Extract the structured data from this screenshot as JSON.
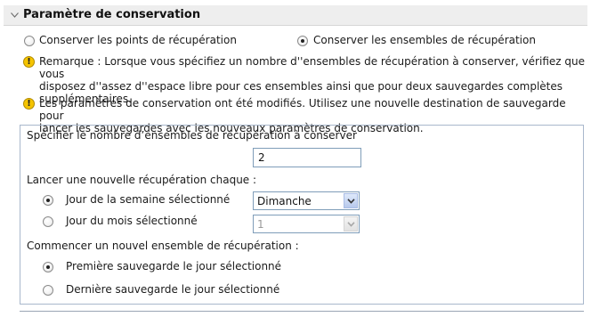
{
  "section": {
    "title": "Paramètre de conservation"
  },
  "mode": {
    "option_points": "Conserver les points de récupération",
    "option_sets": "Conserver les ensembles de récupération",
    "selected": "sets"
  },
  "notes": {
    "remark": [
      "Remarque : Lorsque vous spécifiez un nombre d''ensembles de récupération à conserver, vérifiez que vous",
      "disposez d''assez d''espace libre pour ces ensembles ainsi que pour deux sauvegardes complètes",
      "supplémentaires."
    ],
    "changed": [
      "Les paramètres de conservation ont été modifiés. Utilisez une nouvelle destination de sauvegarde pour",
      "lancer les sauvegardes avec les nouveaux paramètres de conservation."
    ]
  },
  "settings": {
    "count_label": "Spécifier le nombre d’ensembles de récupération à conserver",
    "count_value": "2",
    "launch_label": "Lancer une nouvelle récupération chaque :",
    "weekday_option": "Jour de la semaine sélectionné",
    "weekday_value": "Dimanche",
    "monthday_option": "Jour du mois sélectionné",
    "monthday_value": "1",
    "launch_selected": "weekday",
    "start_label": "Commencer un nouvel ensemble de récupération :",
    "first_option": "Première sauvegarde le jour sélectionné",
    "last_option": "Dernière sauvegarde le jour sélectionné",
    "start_selected": "first"
  },
  "icons": {
    "collapse": "chevron-down-icon",
    "warning": "warning-icon"
  },
  "colors": {
    "header_bg": "#eeeeee",
    "box_border": "#a9b8cc",
    "input_border": "#7f9db9",
    "warning": "#f5c400"
  }
}
